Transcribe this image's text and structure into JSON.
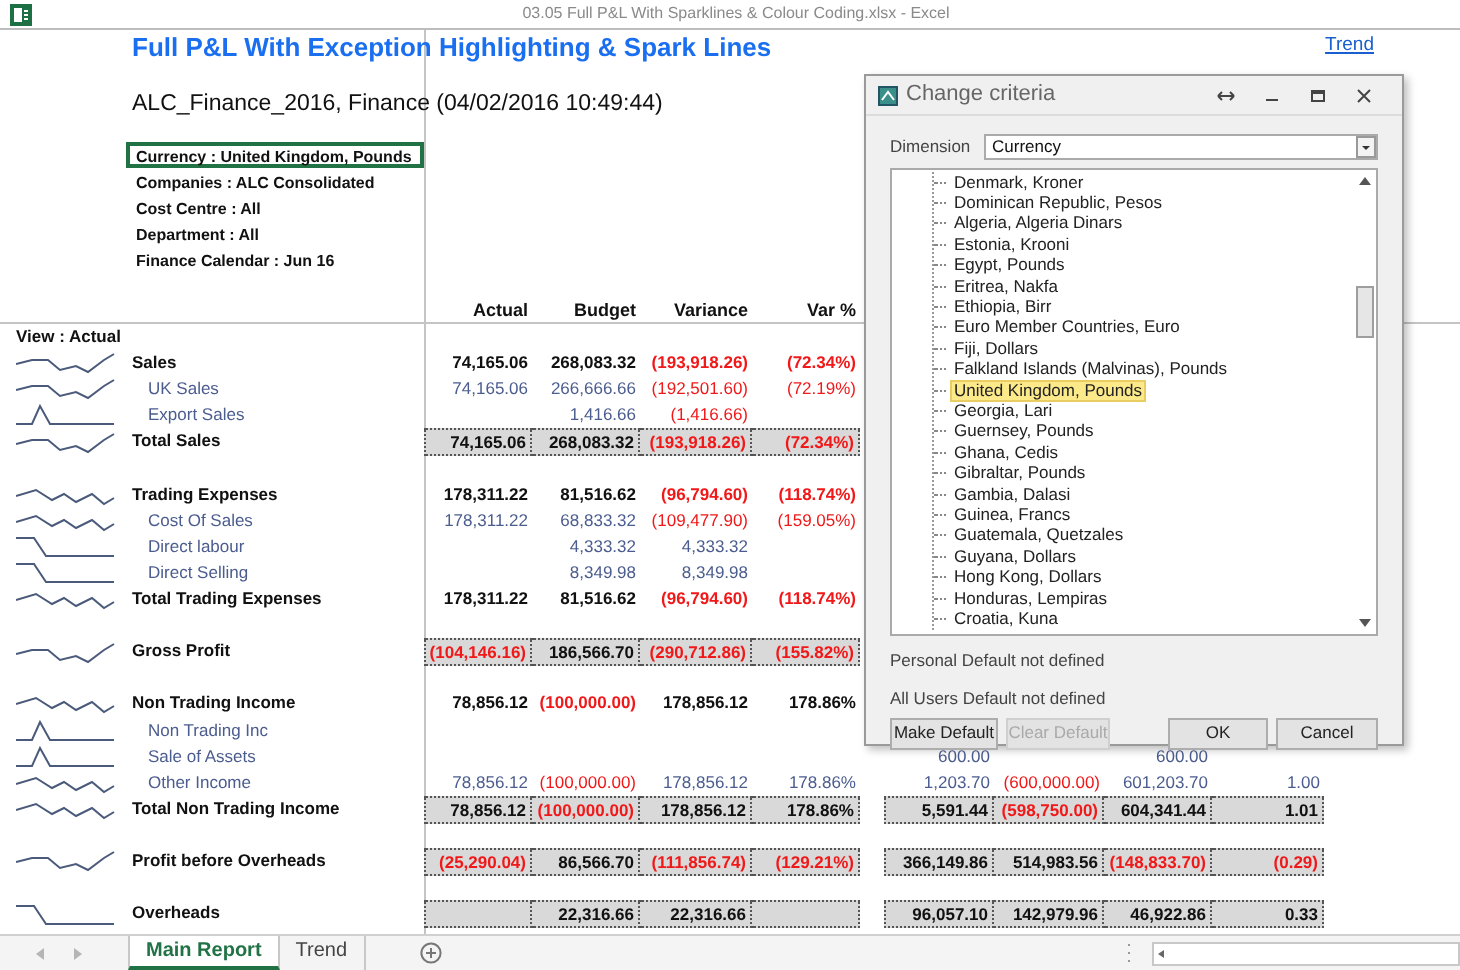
{
  "window": {
    "title": "03.05 Full P&L With Sparklines & Colour Coding.xlsx - Excel"
  },
  "report": {
    "title": "Full P&L With Exception Highlighting & Spark Lines",
    "link": "Trend",
    "subtitle": "ALC_Finance_2016, Finance (04/02/2016 10:49:44)",
    "criteria": [
      {
        "text": "Currency : United Kingdom, Pounds",
        "selected": true
      },
      {
        "text": "Companies : ALC Consolidated",
        "selected": false
      },
      {
        "text": "Cost Centre : All",
        "selected": false
      },
      {
        "text": "Department : All",
        "selected": false
      },
      {
        "text": "Finance Calendar : Jun 16",
        "selected": false
      }
    ],
    "columns": [
      "Actual",
      "Budget",
      "Variance",
      "Var %"
    ],
    "view_label": "View : Actual",
    "rows": [
      {
        "kind": "section",
        "label": "Sales",
        "values": {
          "actual": {
            "text": "74,165.06",
            "negative": false
          },
          "budget": {
            "text": "268,083.32",
            "negative": false
          },
          "variance": {
            "text": "(193,918.26)",
            "negative": true
          },
          "var_pct": {
            "text": "(72.34%)",
            "negative": true
          }
        }
      },
      {
        "kind": "item",
        "label": "UK Sales",
        "values": {
          "actual": {
            "text": "74,165.06",
            "negative": false
          },
          "budget": {
            "text": "266,666.66",
            "negative": false
          },
          "variance": {
            "text": "(192,501.60)",
            "negative": true
          },
          "var_pct": {
            "text": "(72.19%)",
            "negative": true
          }
        }
      },
      {
        "kind": "item",
        "label": "Export Sales",
        "values": {
          "budget": {
            "text": "1,416.66",
            "negative": false
          },
          "variance": {
            "text": "(1,416.66)",
            "negative": true
          }
        }
      },
      {
        "kind": "total",
        "label": "Total Sales",
        "values": {
          "actual": {
            "text": "74,165.06",
            "negative": false
          },
          "budget": {
            "text": "268,083.32",
            "negative": false
          },
          "variance": {
            "text": "(193,918.26)",
            "negative": true
          },
          "var_pct": {
            "text": "(72.34%)",
            "negative": true
          }
        }
      },
      {
        "kind": "blank"
      },
      {
        "kind": "section",
        "label": "Trading Expenses",
        "values": {
          "actual": {
            "text": "178,311.22",
            "negative": false
          },
          "budget": {
            "text": "81,516.62",
            "negative": false
          },
          "variance": {
            "text": "(96,794.60)",
            "negative": true
          },
          "var_pct": {
            "text": "(118.74%)",
            "negative": true
          }
        }
      },
      {
        "kind": "item",
        "label": "Cost Of Sales",
        "values": {
          "actual": {
            "text": "178,311.22",
            "negative": false
          },
          "budget": {
            "text": "68,833.32",
            "negative": false
          },
          "variance": {
            "text": "(109,477.90)",
            "negative": true
          },
          "var_pct": {
            "text": "(159.05%)",
            "negative": true
          }
        }
      },
      {
        "kind": "item",
        "label": "Direct labour",
        "values": {
          "budget": {
            "text": "4,333.32",
            "negative": false
          },
          "variance": {
            "text": "4,333.32",
            "negative": false
          }
        }
      },
      {
        "kind": "item",
        "label": "Direct Selling",
        "values": {
          "budget": {
            "text": "8,349.98",
            "negative": false
          },
          "variance": {
            "text": "8,349.98",
            "negative": false
          }
        }
      },
      {
        "kind": "section",
        "label": "Total Trading Expenses",
        "values": {
          "actual": {
            "text": "178,311.22",
            "negative": false
          },
          "budget": {
            "text": "81,516.62",
            "negative": false
          },
          "variance": {
            "text": "(96,794.60)",
            "negative": true
          },
          "var_pct": {
            "text": "(118.74%)",
            "negative": true
          }
        }
      },
      {
        "kind": "blank"
      },
      {
        "kind": "total",
        "label": "Gross Profit",
        "values": {
          "actual": {
            "text": "(104,146.16)",
            "negative": true
          },
          "budget": {
            "text": "186,566.70",
            "negative": false
          },
          "variance": {
            "text": "(290,712.86)",
            "negative": true
          },
          "var_pct": {
            "text": "(155.82%)",
            "negative": true
          }
        }
      },
      {
        "kind": "blank"
      },
      {
        "kind": "section",
        "label": "Non Trading Income",
        "values": {
          "actual": {
            "text": "78,856.12",
            "negative": false
          },
          "budget": {
            "text": "(100,000.00)",
            "negative": true
          },
          "variance": {
            "text": "178,856.12",
            "negative": false
          },
          "var_pct": {
            "text": "178.86%",
            "negative": false
          }
        }
      },
      {
        "kind": "item",
        "label": "Non Trading Inc"
      },
      {
        "kind": "item",
        "label": "Sale of Assets",
        "values": {
          "column_5": {
            "text": "600.00",
            "negative": false
          },
          "column_7": {
            "text": "600.00",
            "negative": false
          }
        }
      },
      {
        "kind": "item",
        "label": "Other Income",
        "values": {
          "actual": {
            "text": "78,856.12",
            "negative": false
          },
          "budget": {
            "text": "(100,000.00)",
            "negative": true
          },
          "variance": {
            "text": "178,856.12",
            "negative": false
          },
          "var_pct": {
            "text": "178.86%",
            "negative": false
          },
          "column_5": {
            "text": "1,203.70",
            "negative": false
          },
          "column_6": {
            "text": "(600,000.00)",
            "negative": true
          },
          "column_7": {
            "text": "601,203.70",
            "negative": false
          },
          "column_8": {
            "text": "1.00",
            "negative": false
          }
        }
      },
      {
        "kind": "total",
        "label": "Total Non Trading Income",
        "values": {
          "actual": {
            "text": "78,856.12",
            "negative": false
          },
          "budget": {
            "text": "(100,000.00)",
            "negative": true
          },
          "variance": {
            "text": "178,856.12",
            "negative": false
          },
          "var_pct": {
            "text": "178.86%",
            "negative": false
          },
          "column_5": {
            "text": "5,591.44",
            "negative": false
          },
          "column_6": {
            "text": "(598,750.00)",
            "negative": true
          },
          "column_7": {
            "text": "604,341.44",
            "negative": false
          },
          "column_8": {
            "text": "1.01",
            "negative": false
          }
        }
      },
      {
        "kind": "blank"
      },
      {
        "kind": "total",
        "label": "Profit before Overheads",
        "values": {
          "actual": {
            "text": "(25,290.04)",
            "negative": true
          },
          "budget": {
            "text": "86,566.70",
            "negative": false
          },
          "variance": {
            "text": "(111,856.74)",
            "negative": true
          },
          "var_pct": {
            "text": "(129.21%)",
            "negative": true
          },
          "column_5": {
            "text": "366,149.86",
            "negative": false
          },
          "column_6": {
            "text": "514,983.56",
            "negative": false
          },
          "column_7": {
            "text": "(148,833.70)",
            "negative": true
          },
          "column_8": {
            "text": "(0.29)",
            "negative": true
          }
        }
      },
      {
        "kind": "blank"
      },
      {
        "kind": "total",
        "label": "Overheads",
        "values": {
          "budget": {
            "text": "22,316.66",
            "negative": false
          },
          "variance": {
            "text": "22,316.66",
            "negative": false
          },
          "column_5": {
            "text": "96,057.10",
            "negative": false
          },
          "column_6": {
            "text": "142,979.96",
            "negative": false
          },
          "column_7": {
            "text": "46,922.86",
            "negative": false
          },
          "column_8": {
            "text": "0.33",
            "negative": false
          }
        }
      }
    ]
  },
  "dialog": {
    "title": "Change criteria",
    "dimension_label": "Dimension",
    "dimension_value": "Currency",
    "tree_items": [
      {
        "label": "Denmark, Kroner",
        "selected": false
      },
      {
        "label": "Dominican Republic, Pesos",
        "selected": false
      },
      {
        "label": "Algeria, Algeria Dinars",
        "selected": false
      },
      {
        "label": "Estonia, Krooni",
        "selected": false
      },
      {
        "label": "Egypt, Pounds",
        "selected": false
      },
      {
        "label": "Eritrea, Nakfa",
        "selected": false
      },
      {
        "label": "Ethiopia, Birr",
        "selected": false
      },
      {
        "label": "Euro Member Countries, Euro",
        "selected": false
      },
      {
        "label": "Fiji, Dollars",
        "selected": false
      },
      {
        "label": "Falkland Islands (Malvinas), Pounds",
        "selected": false
      },
      {
        "label": "United Kingdom, Pounds",
        "selected": true
      },
      {
        "label": "Georgia, Lari",
        "selected": false
      },
      {
        "label": "Guernsey, Pounds",
        "selected": false
      },
      {
        "label": "Ghana, Cedis",
        "selected": false
      },
      {
        "label": "Gibraltar, Pounds",
        "selected": false
      },
      {
        "label": "Gambia, Dalasi",
        "selected": false
      },
      {
        "label": "Guinea, Francs",
        "selected": false
      },
      {
        "label": "Guatemala, Quetzales",
        "selected": false
      },
      {
        "label": "Guyana, Dollars",
        "selected": false
      },
      {
        "label": "Hong Kong, Dollars",
        "selected": false
      },
      {
        "label": "Honduras, Lempiras",
        "selected": false
      },
      {
        "label": "Croatia, Kuna",
        "selected": false
      }
    ],
    "personal_default": "Personal Default not defined",
    "all_users_default": "All Users Default not defined",
    "left_buttons": [
      {
        "label": "Make Default",
        "disabled": false
      },
      {
        "label": "Clear Default",
        "disabled": true
      }
    ],
    "right_buttons": [
      {
        "label": "OK",
        "disabled": false
      },
      {
        "label": "Cancel",
        "disabled": false
      }
    ]
  },
  "sheet_tabs": [
    {
      "label": "Main Report",
      "selected": true
    },
    {
      "label": "Trend",
      "selected": false
    }
  ]
}
